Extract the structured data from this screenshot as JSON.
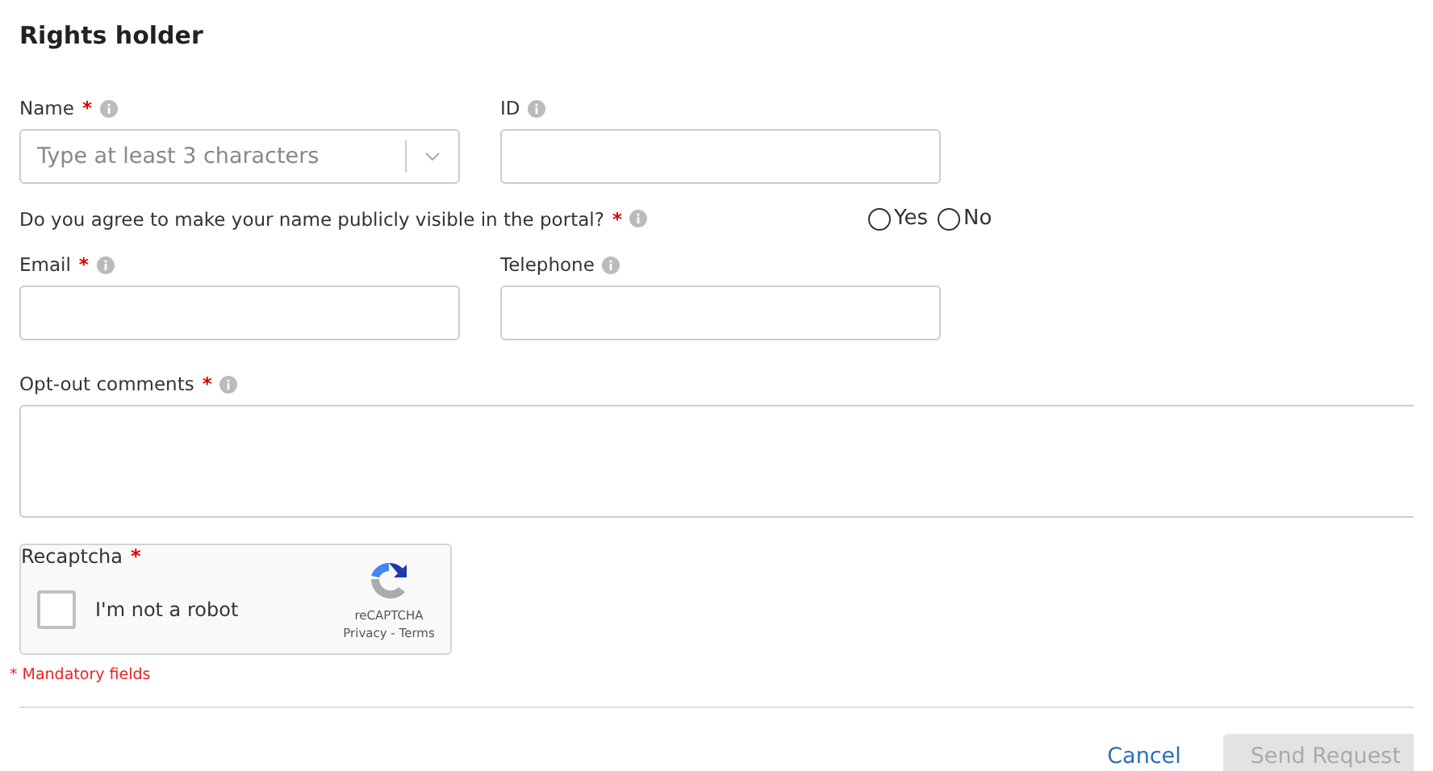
{
  "title": "Rights holder",
  "row1": [
    {
      "label": "Name",
      "mark": "*",
      "kind": "combo",
      "placeholder": "Type at least 3 characters"
    },
    {
      "label": "ID",
      "kind": "text"
    }
  ],
  "question": {
    "label": "Do you agree to make your name publicly visible in the portal?",
    "mark": "*",
    "options": [
      {
        "label": "Yes",
        "selected": false
      },
      {
        "label": "No",
        "selected": false
      }
    ]
  },
  "row2": [
    {
      "label": "Email",
      "mark": "*",
      "kind": "text"
    },
    {
      "label": "Telephone",
      "kind": "text"
    }
  ],
  "comments": {
    "label": "Opt-out comments",
    "mark": "*"
  },
  "captcha": {
    "label": "Recaptcha",
    "mark": "*",
    "checkbox_label": "I'm not a robot",
    "checked": false,
    "brand": "reCAPTCHA",
    "links": "Privacy - Terms"
  },
  "mandatory_note": "* Mandatory fields",
  "buttons": [
    {
      "label": "Cancel",
      "kind": "link",
      "disabled": false
    },
    {
      "label": "Send Request",
      "kind": "primary",
      "disabled": true
    }
  ]
}
